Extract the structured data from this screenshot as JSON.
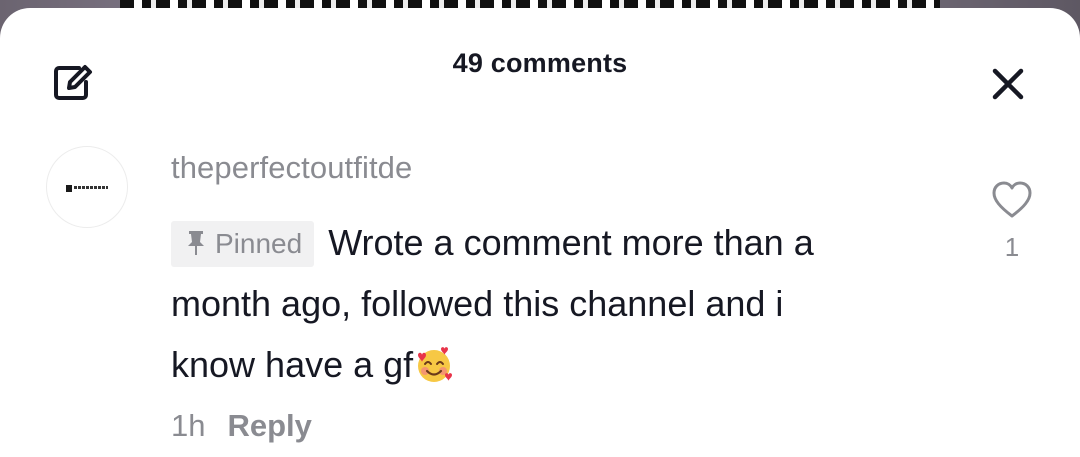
{
  "header": {
    "title": "49 comments",
    "edit_icon": "edit-icon",
    "close_icon": "close-icon"
  },
  "comment": {
    "username": "theperfectoutfitde",
    "pinned_label": "Pinned",
    "text_line1": "Wrote a comment more than a",
    "text_line2": "month ago, followed this channel and i",
    "text_line3": "know have a gf",
    "emoji": "smiling-face-with-hearts",
    "time": "1h",
    "reply_label": "Reply",
    "like_count": "1",
    "like_icon": "heart-outline-icon"
  },
  "colors": {
    "text_primary": "#161823",
    "text_secondary": "#8a8b91",
    "badge_background": "#f1f1f2"
  }
}
